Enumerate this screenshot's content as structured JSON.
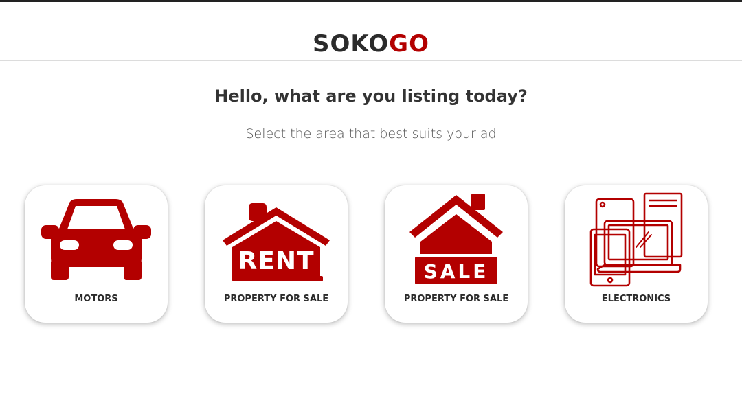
{
  "header": {
    "logo_part_a": "SOKO",
    "logo_part_b": "GO",
    "logo_color_dark": "#2b2b2b",
    "logo_color_accent": "#b30000"
  },
  "main": {
    "title": "Hello, what are you listing today?",
    "subtitle": "Select the area that best suits your ad"
  },
  "categories": [
    {
      "label": "MOTORS",
      "icon": "car-icon",
      "icon_text": ""
    },
    {
      "label": "PROPERTY FOR SALE",
      "icon": "house-rent-icon",
      "icon_text": "RENT"
    },
    {
      "label": "PROPERTY FOR SALE",
      "icon": "house-sale-icon",
      "icon_text": "SALE"
    },
    {
      "label": "ELECTRONICS",
      "icon": "devices-icon",
      "icon_text": ""
    }
  ],
  "colors": {
    "accent": "#b30000",
    "text": "#333333",
    "card_bg": "#ffffff"
  }
}
